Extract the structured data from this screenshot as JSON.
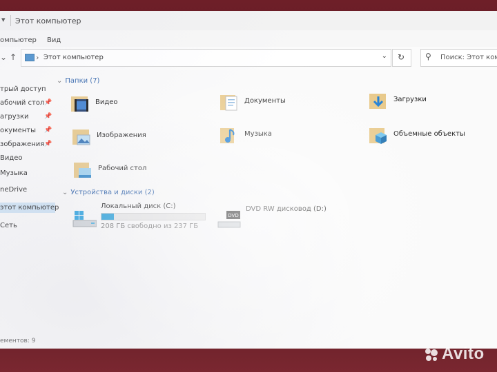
{
  "window": {
    "title": "Этот компьютер"
  },
  "ribbon": {
    "tabs": [
      "омпьютер",
      "Вид"
    ]
  },
  "address": {
    "crumb": "Этот компьютер",
    "search_placeholder": "Поиск: Этот компь"
  },
  "navpane": {
    "items": [
      {
        "label": "трый доступ",
        "pinned": false
      },
      {
        "label": "абочий стол",
        "pinned": true
      },
      {
        "label": "агрузки",
        "pinned": true
      },
      {
        "label": "окументы",
        "pinned": true
      },
      {
        "label": "зображения",
        "pinned": true
      },
      {
        "label": "Видео",
        "pinned": false
      },
      {
        "label": "Музыка",
        "pinned": false
      },
      {
        "label": "neDrive",
        "pinned": false
      },
      {
        "label": "этот компьютер",
        "pinned": false,
        "selected": true
      },
      {
        "label": "Сеть",
        "pinned": false
      }
    ]
  },
  "folders_group": {
    "title": "Папки (7)",
    "items": [
      {
        "label": "Видео",
        "icon": "video-folder-icon"
      },
      {
        "label": "Документы",
        "icon": "documents-folder-icon"
      },
      {
        "label": "Загрузки",
        "icon": "downloads-folder-icon"
      },
      {
        "label": "Изображения",
        "icon": "pictures-folder-icon"
      },
      {
        "label": "Музыка",
        "icon": "music-folder-icon"
      },
      {
        "label": "Объемные объекты",
        "icon": "3d-objects-folder-icon"
      },
      {
        "label": "Рабочий стол",
        "icon": "desktop-folder-icon"
      }
    ]
  },
  "devices_group": {
    "title": "Устройства и диски (2)",
    "drives": [
      {
        "label": "Локальный диск (C:)",
        "free_text": "208 ГБ свободно из 237 ГБ",
        "used_fraction": 0.12,
        "icon": "local-disk-icon"
      },
      {
        "label": "DVD RW дисковод (D:)",
        "icon": "dvd-drive-icon"
      }
    ]
  },
  "status": {
    "text": "ементов: 9"
  },
  "watermark": {
    "text": "Avito"
  },
  "colors": {
    "accent": "#26a0da",
    "group_head": "#2a5fa8",
    "selection": "#cfe4f5"
  }
}
